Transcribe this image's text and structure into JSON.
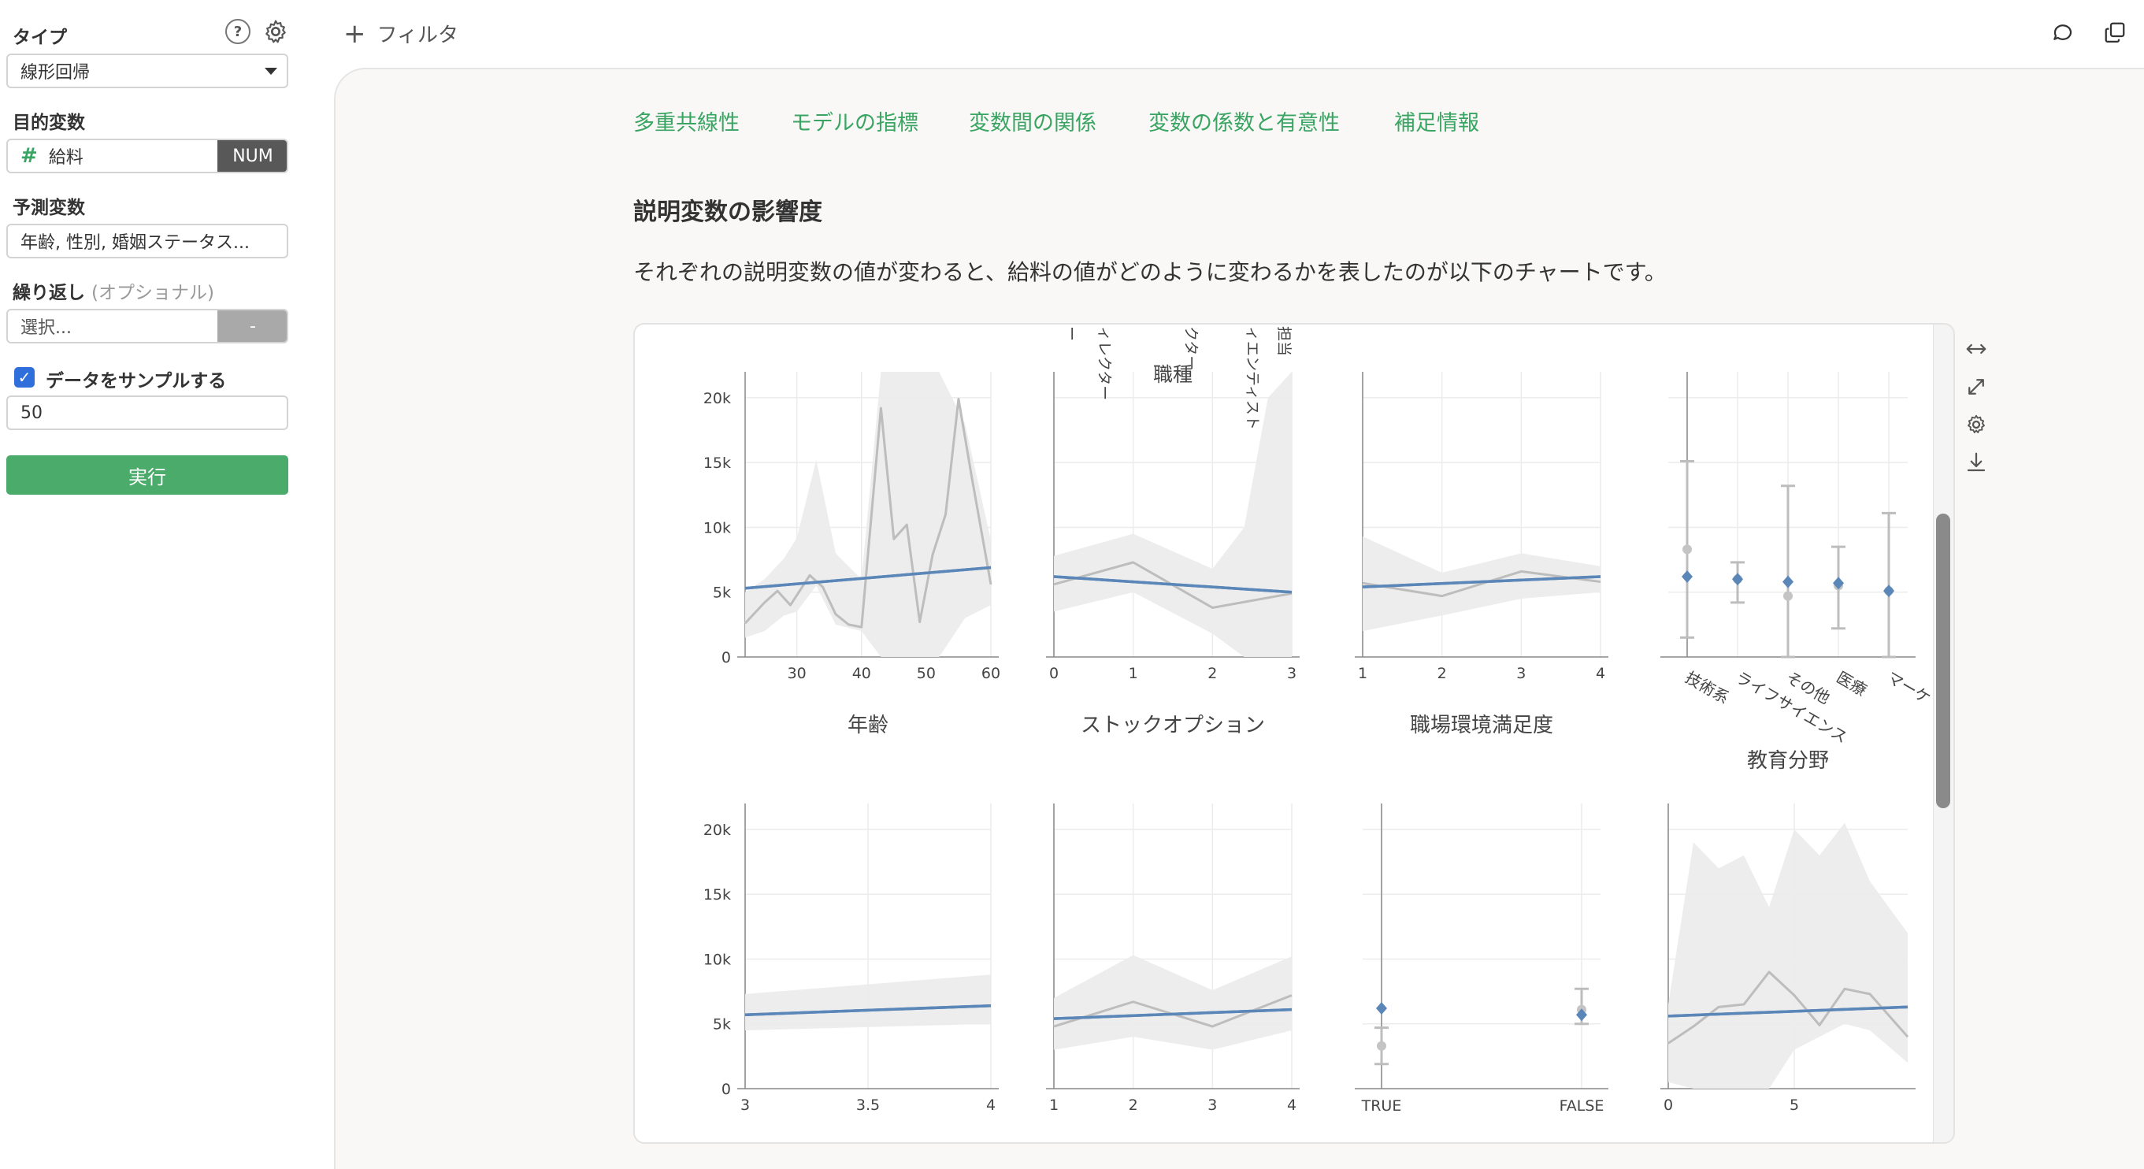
{
  "sidebar": {
    "type_label": "タイプ",
    "type_value": "線形回帰",
    "target_label": "目的変数",
    "target_value": "給料",
    "target_badge": "NUM",
    "predictors_label": "予測変数",
    "predictors_value": "年齢, 性別, 婚姻ステータス...",
    "repeat_label": "繰り返し",
    "repeat_optional": "(オプショナル)",
    "repeat_placeholder": "選択...",
    "repeat_badge": "-",
    "sample_label": "データをサンプルする",
    "sample_value": "50",
    "run_label": "実行",
    "help_icon": "?"
  },
  "topbar": {
    "filter_label": "フィルタ"
  },
  "tabs": [
    "多重共線性",
    "モデルの指標",
    "変数間の関係",
    "変数の係数と有意性",
    "補足情報"
  ],
  "section": {
    "title": "説明変数の影響度",
    "description": "それぞれの説明変数の値が変わると、給料の値がどのように変わるかを表したのが以下のチャートです。"
  },
  "colors": {
    "accent_green": "#3aa563",
    "model_line": "#5b86b8",
    "data_line": "#bdbdbd",
    "ci_band": "#ececec"
  },
  "chart_data": [
    {
      "type": "line",
      "xlabel": "年齢",
      "xticks": [
        "30",
        "40",
        "50",
        "60"
      ],
      "xlim": [
        22,
        60
      ],
      "yticks": [
        "0",
        "5k",
        "10k",
        "15k",
        "20k"
      ],
      "ylim": [
        0,
        22000
      ],
      "series": [
        {
          "values_x": [
            22,
            60
          ],
          "values_y": [
            5300,
            6900
          ]
        },
        {
          "values_x": [
            22,
            25,
            27,
            29,
            32,
            34,
            36,
            38,
            40,
            43,
            45,
            47,
            49,
            51,
            53,
            55,
            57,
            60
          ],
          "values_y": [
            2600,
            4200,
            5100,
            4000,
            6300,
            5400,
            3300,
            2500,
            2300,
            19200,
            9100,
            10200,
            2700,
            7900,
            11000,
            19900,
            14000,
            5600
          ]
        }
      ]
    },
    {
      "type": "line",
      "xlabel": "ストックオプション",
      "xticks": [
        "0",
        "1",
        "2",
        "3"
      ],
      "xlim": [
        0,
        3
      ],
      "yticks": [],
      "ylim": [
        0,
        22000
      ],
      "top_label": "職種",
      "rotated_labels": [
        "ー",
        "ィレクター",
        "クター",
        "ィエンティスト",
        "担当"
      ],
      "series": [
        {
          "values_x": [
            0,
            3
          ],
          "values_y": [
            6200,
            5000
          ]
        },
        {
          "values_x": [
            0,
            1,
            2,
            3
          ],
          "values_y": [
            5600,
            7300,
            3800,
            4900
          ]
        }
      ]
    },
    {
      "type": "line",
      "xlabel": "職場環境満足度",
      "xticks": [
        "1",
        "2",
        "3",
        "4"
      ],
      "xlim": [
        1,
        4
      ],
      "yticks": [],
      "ylim": [
        0,
        22000
      ],
      "series": [
        {
          "values_x": [
            1,
            4
          ],
          "values_y": [
            5400,
            6200
          ]
        },
        {
          "values_x": [
            1,
            2,
            3,
            4
          ],
          "values_y": [
            5700,
            4700,
            6600,
            5800
          ]
        }
      ]
    },
    {
      "type": "scatter",
      "xlabel": "教育分野",
      "categories": [
        "技術系",
        "ライフサイエンス",
        "その他",
        "医療",
        "マーケ"
      ],
      "ylim": [
        0,
        22000
      ],
      "yticks": [],
      "model_values": [
        6200,
        6000,
        5800,
        5700,
        5100
      ],
      "data_values": [
        8300,
        6000,
        4700,
        5500,
        5100
      ],
      "error_low": [
        1500,
        4200,
        0,
        2200,
        0
      ],
      "error_high": [
        15100,
        7300,
        13200,
        8500,
        11100
      ]
    },
    {
      "type": "line",
      "xlabel": "",
      "xticks": [
        "3",
        "3.5",
        "4"
      ],
      "xlim": [
        3,
        4
      ],
      "yticks": [
        "0",
        "5k",
        "10k",
        "15k",
        "20k"
      ],
      "ylim": [
        0,
        22000
      ],
      "series": [
        {
          "values_x": [
            3,
            4
          ],
          "values_y": [
            5700,
            6400
          ]
        }
      ]
    },
    {
      "type": "line",
      "xlabel": "",
      "xticks": [
        "1",
        "2",
        "3",
        "4"
      ],
      "xlim": [
        1,
        4
      ],
      "yticks": [],
      "ylim": [
        0,
        22000
      ],
      "series": [
        {
          "values_x": [
            1,
            4
          ],
          "values_y": [
            5400,
            6100
          ]
        },
        {
          "values_x": [
            1,
            2,
            3,
            4
          ],
          "values_y": [
            4800,
            6700,
            4800,
            7200
          ]
        }
      ]
    },
    {
      "type": "scatter",
      "xlabel": "",
      "categories": [
        "TRUE",
        "FALSE"
      ],
      "ylim": [
        0,
        22000
      ],
      "yticks": [],
      "model_values": [
        6200,
        5700
      ],
      "data_values": [
        3300,
        6100
      ],
      "error_low": [
        1900,
        5000
      ],
      "error_high": [
        4700,
        7700
      ]
    },
    {
      "type": "line",
      "xlabel": "",
      "xticks": [
        "0",
        "5"
      ],
      "xlim": [
        0,
        9.5
      ],
      "yticks": [],
      "ylim": [
        0,
        22000
      ],
      "series": [
        {
          "values_x": [
            0,
            9.5
          ],
          "values_y": [
            5600,
            6300
          ]
        },
        {
          "values_x": [
            0,
            1,
            2,
            3,
            4,
            5,
            6,
            7,
            8,
            9.5
          ],
          "values_y": [
            3500,
            4800,
            6300,
            6500,
            9000,
            7200,
            4900,
            7700,
            7300,
            4000
          ]
        }
      ]
    }
  ]
}
